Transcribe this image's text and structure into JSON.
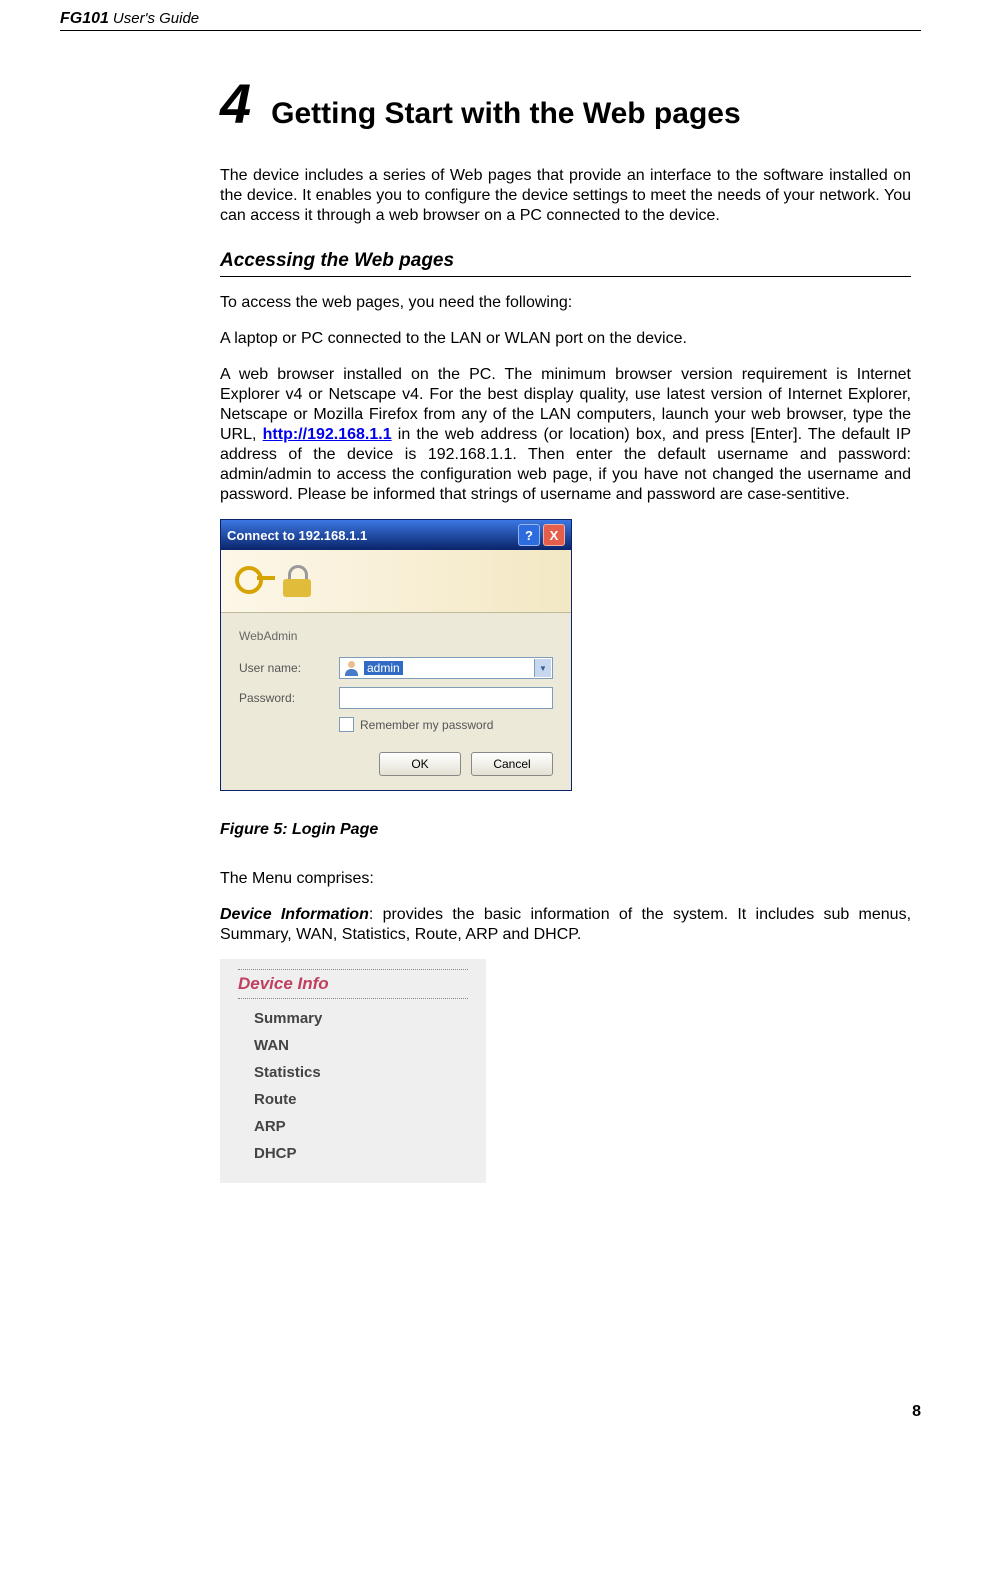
{
  "header": {
    "brand": "FG101",
    "title": "User's Guide"
  },
  "chapter": {
    "number": "4",
    "title": "Getting Start with the Web pages"
  },
  "intro": "The device includes a series of Web pages that provide an interface to the software installed on the device. It enables you to configure the device settings to meet the needs of your network. You can access it through a web browser on a PC connected to the device.",
  "section_heading": "Accessing the Web pages",
  "access_p1": "To access the web pages, you need the following:",
  "access_p2": "A laptop or PC connected to the LAN or WLAN port on the device.",
  "access_p3_a": "A web browser installed on the PC. The minimum browser version requirement is Internet Explorer v4 or Netscape v4. For the best display quality, use latest version of Internet Explorer, Netscape or Mozilla Firefox  from any of the LAN computers, launch your web browser, type the URL, ",
  "access_p3_link": "http://192.168.1.1",
  "access_p3_b": " in the web address (or location) box, and press [Enter]. The default IP address of the device is 192.168.1.1. Then enter the default username and password: admin/admin to access the configuration web page, if you have not changed the username and password. Please be informed that strings of username and password are case-sentitive.",
  "dialog": {
    "title": "Connect to 192.168.1.1",
    "help": "?",
    "close": "X",
    "realm": "WebAdmin",
    "username_label": "User name:",
    "username_value": "admin",
    "password_label": "Password:",
    "remember": "Remember my password",
    "ok": "OK",
    "cancel": "Cancel"
  },
  "figure_caption": "Figure 5: Login Page",
  "menu_intro": "The Menu comprises:",
  "devinfo_label": "Device Information",
  "devinfo_text": ": provides the basic information of the system. It includes sub menus, Summary, WAN, Statistics, Route, ARP and DHCP.",
  "sidemenu": {
    "title": "Device Info",
    "items": [
      "Summary",
      "WAN",
      "Statistics",
      "Route",
      "ARP",
      "DHCP"
    ]
  },
  "page_number": "8"
}
